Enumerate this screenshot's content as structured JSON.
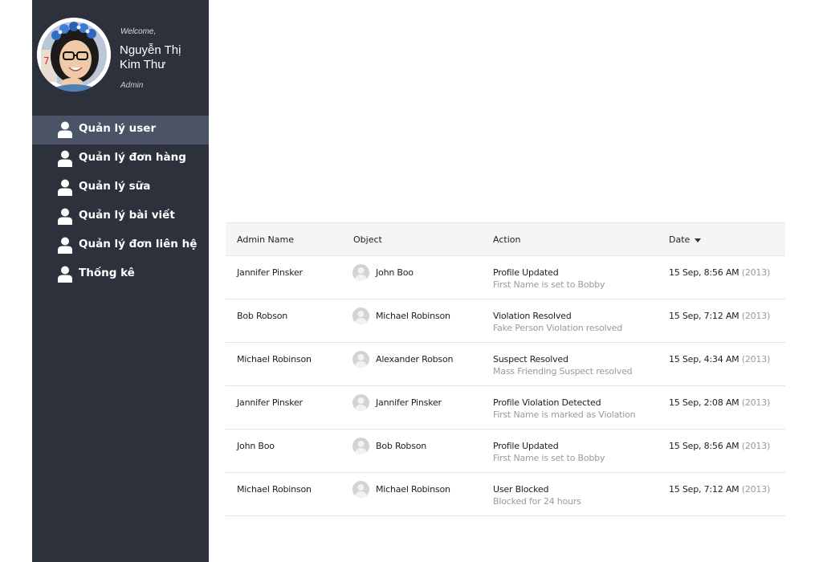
{
  "profile": {
    "welcome": "Welcome,",
    "name": "Nguyễn Thị Kim Thư",
    "role": "Admin"
  },
  "nav": [
    {
      "label": "Quản lý user",
      "icon": "user-icon",
      "active": true
    },
    {
      "label": "Quản lý đơn hàng",
      "icon": "user-icon",
      "active": false
    },
    {
      "label": "Quản lý sữa",
      "icon": "user-icon",
      "active": false
    },
    {
      "label": "Quản lý bài viết",
      "icon": "user-icon",
      "active": false
    },
    {
      "label": "Quản lý đơn liên hệ",
      "icon": "user-icon",
      "active": false
    },
    {
      "label": "Thống kê",
      "icon": "user-icon",
      "active": false
    }
  ],
  "table": {
    "headers": {
      "admin": "Admin Name",
      "object": "Object",
      "action": "Action",
      "date": "Date"
    },
    "rows": [
      {
        "admin": "Jannifer Pinsker",
        "object": "John Boo",
        "action": "Profile Updated",
        "detail": "First Name is set to Bobby",
        "date": "15 Sep, 8:56 AM",
        "year": "(2013)"
      },
      {
        "admin": "Bob Robson",
        "object": "Michael Robinson",
        "action": "Violation Resolved",
        "detail": "Fake Person Violation resolved",
        "date": "15 Sep, 7:12 AM",
        "year": "(2013)"
      },
      {
        "admin": "Michael Robinson",
        "object": "Alexander Robson",
        "action": "Suspect Resolved",
        "detail": "Mass Friending Suspect resolved",
        "date": "15 Sep, 4:34 AM",
        "year": "(2013)"
      },
      {
        "admin": "Jannifer Pinsker",
        "object": "Jannifer Pinsker",
        "action": "Profile Violation Detected",
        "detail": "First Name is marked as Violation",
        "date": "15 Sep, 2:08 AM",
        "year": "(2013)"
      },
      {
        "admin": "John Boo",
        "object": "Bob Robson",
        "action": "Profile Updated",
        "detail": "First Name is set to Bobby",
        "date": "15 Sep, 8:56 AM",
        "year": "(2013)"
      },
      {
        "admin": "Michael Robinson",
        "object": "Michael Robinson",
        "action": "User Blocked",
        "detail": "Blocked for 24 hours",
        "date": "15 Sep, 7:12 AM",
        "year": "(2013)"
      }
    ]
  },
  "colors": {
    "sidebar_bg": "#2c313b",
    "nav_active_bg": "#4b5466",
    "header_bg": "#f5f5f5",
    "muted_text": "#9a9a9a"
  }
}
